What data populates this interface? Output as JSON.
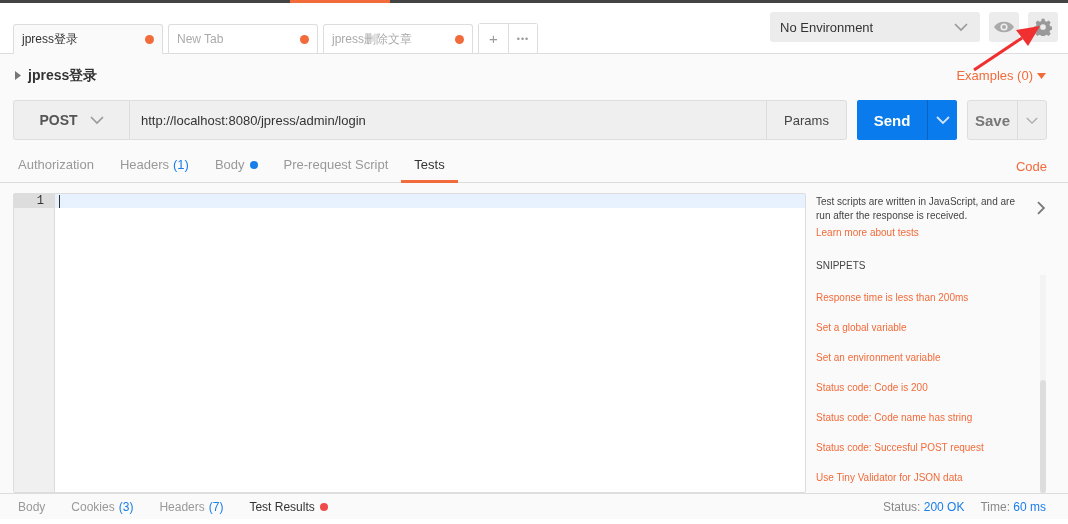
{
  "tabs": [
    {
      "title": "jpress登录",
      "unsaved": true,
      "selected": true
    },
    {
      "title": "New Tab",
      "unsaved": true,
      "selected": false
    },
    {
      "title": "jpress删除文章",
      "unsaved": true,
      "selected": false
    }
  ],
  "new_tab_button": "+",
  "more_button": "•••",
  "environment": {
    "value": "No Environment"
  },
  "request": {
    "name": "jpress登录",
    "examples": "Examples (0)",
    "method": "POST",
    "url": "http://localhost:8080/jpress/admin/login",
    "params": "Params",
    "send": "Send",
    "save": "Save"
  },
  "request_tabs": [
    {
      "label": "Authorization",
      "selected": false
    },
    {
      "label": "Headers",
      "count": "(1)",
      "selected": false
    },
    {
      "label": "Body",
      "color": "#1a7ee8",
      "selected": false
    },
    {
      "label": "Pre-request Script",
      "selected": false
    },
    {
      "label": "Tests",
      "selected": true
    }
  ],
  "code_link": "Code",
  "editor": {
    "line_numbers": [
      "1"
    ]
  },
  "sidebar": {
    "description": "Test scripts are written in JavaScript, and are run after the response is received.",
    "learn_more": "Learn more about tests",
    "snippets_heading": "SNIPPETS",
    "snippets": [
      "Response time is less than 200ms",
      "Set a global variable",
      "Set an environment variable",
      "Status code: Code is 200",
      "Status code: Code name has string",
      "Status code: Succesful POST request",
      "Use Tiny Validator for JSON data"
    ]
  },
  "response_tabs": [
    {
      "label": "Body",
      "selected": false
    },
    {
      "label": "Cookies",
      "count": "(3)",
      "selected": false
    },
    {
      "label": "Headers",
      "count": "(7)",
      "selected": false
    },
    {
      "label": "Test Results",
      "color": "#ed4b48",
      "selected": true
    }
  ],
  "status": {
    "label": "Status:",
    "value": "200 OK"
  },
  "time": {
    "label": "Time:",
    "value": "60 ms"
  }
}
